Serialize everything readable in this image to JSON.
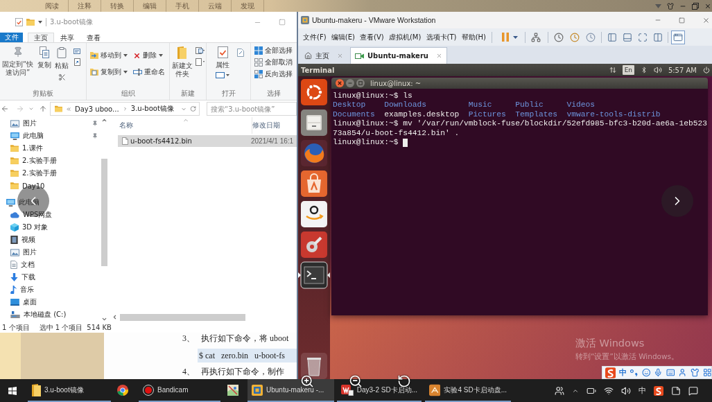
{
  "reader_toolbar": {
    "tabs": [
      "阅读",
      "注释",
      "转换",
      "编辑",
      "手机",
      "云端",
      "发现"
    ]
  },
  "explorer": {
    "title": "3.u-boot镜像",
    "ribbon_tabs": [
      {
        "label": "文件",
        "kind": "menu",
        "selected": false
      },
      {
        "label": "主页",
        "kind": "tab",
        "selected": true
      },
      {
        "label": "共享",
        "kind": "tab",
        "selected": false
      },
      {
        "label": "查看",
        "kind": "tab",
        "selected": false
      }
    ],
    "ribbon_groups": [
      {
        "label": "剪贴板",
        "commands": [
          "固定到“快速访问”",
          "复制",
          "粘贴"
        ]
      },
      {
        "label": "组织",
        "commands": [
          "移动到",
          "删除",
          "复制到",
          "重命名"
        ]
      },
      {
        "label": "新建",
        "commands": [
          "新建文件夹"
        ]
      },
      {
        "label": "打开",
        "commands": [
          "属性"
        ]
      },
      {
        "label": "选择",
        "commands": [
          "全部选择",
          "全部取消",
          "反向选择"
        ]
      }
    ],
    "address": {
      "segments": [
        "Day3 uboo...",
        "3.u-boot镜像"
      ]
    },
    "search": {
      "placeholder": "搜索“3.u-boot镜像”"
    },
    "quick_access": [
      {
        "label": "图片",
        "pinned": true
      },
      {
        "label": "此电脑",
        "pinned": true
      },
      {
        "label": "1.课件",
        "pinned": false
      },
      {
        "label": "2.实验手册",
        "pinned": false
      },
      {
        "label": "2.实验手册",
        "pinned": false
      },
      {
        "label": "Day10",
        "pinned": false
      }
    ],
    "this_pc": {
      "label": "此电脑",
      "children": [
        {
          "label": "WPS网盘"
        },
        {
          "label": "3D 对象"
        },
        {
          "label": "视频"
        },
        {
          "label": "图片"
        },
        {
          "label": "文档"
        },
        {
          "label": "下载"
        },
        {
          "label": "音乐"
        },
        {
          "label": "桌面"
        },
        {
          "label": "本地磁盘 (C:)"
        }
      ]
    },
    "columns": [
      {
        "label": "名称",
        "sorted": true
      },
      {
        "label": "修改日期",
        "sorted": false
      }
    ],
    "files": [
      {
        "name": "u-boot-fs4412.bin",
        "modified": "2021/4/1 16:1",
        "selected": true
      }
    ],
    "status_bar": {
      "item_count": "1 个项目",
      "selection": "选中 1 个项目",
      "size": "514 KB"
    }
  },
  "document": {
    "lines": [
      {
        "kind": "step",
        "number": "3、",
        "text": "执行如下命令，将 uboot"
      },
      {
        "kind": "code",
        "text": "$ cat   zero.bin   u-boot-fs"
      },
      {
        "kind": "step",
        "number": "4、",
        "text": "再执行如下命令，制作"
      }
    ]
  },
  "vmware": {
    "title": "Ubuntu-makeru - VMware Workstation",
    "menu": [
      "文件(F)",
      "编辑(E)",
      "查看(V)",
      "虚拟机(M)",
      "选项卡(T)",
      "帮助(H)"
    ],
    "view_toggles": [
      {
        "pressed": false
      },
      {
        "pressed": false
      },
      {
        "pressed": false
      },
      {
        "pressed": false
      },
      {
        "pressed": true
      }
    ],
    "tabs": [
      {
        "label": "主页",
        "selected": false
      },
      {
        "label": "Ubuntu-makeru",
        "selected": true
      }
    ],
    "guest": {
      "panel": {
        "app_title": "Terminal",
        "keyboard_layout": "En",
        "clock": "5:57 AM"
      },
      "launcher": [
        {
          "focused": false
        },
        {
          "focused": false
        },
        {
          "focused": false
        },
        {
          "focused": false
        },
        {
          "focused": false
        },
        {
          "focused": false
        },
        {
          "focused": true
        }
      ],
      "terminal": {
        "title": "linux@linux: ~",
        "lines": [
          {
            "kind": "prompt",
            "prompt": "linux@linux:~$",
            "command": "ls",
            "cursor": false
          },
          {
            "kind": "listing",
            "entries": [
              {
                "name": "Desktop",
                "directory": true
              },
              {
                "name": "Downloads",
                "directory": true
              },
              {
                "name": "Music",
                "directory": true
              },
              {
                "name": "Public",
                "directory": true
              },
              {
                "name": "Videos",
                "directory": true
              }
            ]
          },
          {
            "kind": "listing",
            "entries": [
              {
                "name": "Documents",
                "directory": true
              },
              {
                "name": "examples.desktop",
                "directory": false
              },
              {
                "name": "Pictures",
                "directory": true
              },
              {
                "name": "Templates",
                "directory": true
              },
              {
                "name": "vmware-tools-distrib",
                "directory": true
              }
            ]
          },
          {
            "kind": "prompt",
            "prompt": "linux@linux:~$",
            "command": "mv '/var/run/vmblock-fuse/blockdir/52efd985-bfc3-b20d-ae6a-1eb523",
            "cursor": false
          },
          {
            "kind": "output",
            "text": "73a854/u-boot-fs4412.bin' ."
          },
          {
            "kind": "prompt",
            "prompt": "linux@linux:~$",
            "cursor": true
          }
        ]
      }
    }
  },
  "activation_notice": {
    "title": "激活 Windows",
    "message": "转到“设置”以激活 Windows。"
  },
  "ime_bar": {
    "mode": "中"
  },
  "taskbar": {
    "items": [
      {
        "label": "3.u-boot镜像",
        "running": true,
        "active": false
      },
      {
        "running": false,
        "active": false
      },
      {
        "label": "Bandicam",
        "running": true,
        "active": false
      },
      {
        "running": false,
        "active": false
      },
      {
        "label": "Ubuntu-makeru -...",
        "running": true,
        "active": true
      },
      {
        "label": "Day3-2 SD卡启动...",
        "running": true,
        "active": false
      },
      {
        "label": "实验4 SD卡启动盘...",
        "running": true,
        "active": false
      }
    ],
    "tray": {
      "input_language": "中"
    }
  }
}
